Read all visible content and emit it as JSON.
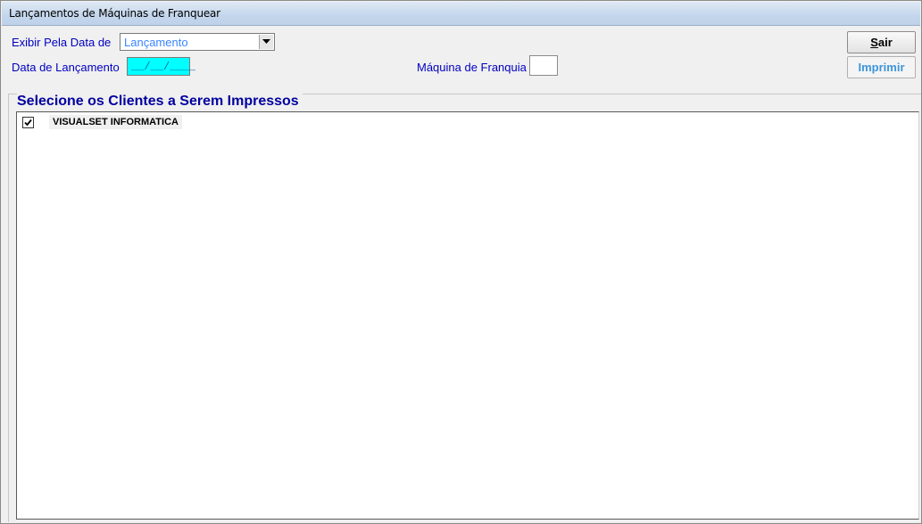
{
  "window": {
    "title": "Lançamentos de Máquinas de Franquear"
  },
  "filters": {
    "exibir_label": "Exibir Pela Data de",
    "exibir_value": "Lançamento",
    "data_label": "Data de Lançamento",
    "data_value": "__/__/____",
    "maquina_label": "Máquina de Franquia",
    "maquina_value": ""
  },
  "buttons": {
    "sair_underline": "S",
    "sair_rest": "air",
    "imprimir": "Imprimir"
  },
  "clients": {
    "title": "Selecione os Clientes a Serem Impressos",
    "items": [
      {
        "label": "VISUALSET INFORMATICA",
        "checked": true
      }
    ]
  },
  "colors": {
    "label": "#0000c0",
    "date_bg": "#00ffff",
    "imprimir_disabled": "#3c96dc"
  },
  "icons": {
    "dropdown": "chevron-down-icon",
    "checkbox": "checkmark-icon"
  }
}
